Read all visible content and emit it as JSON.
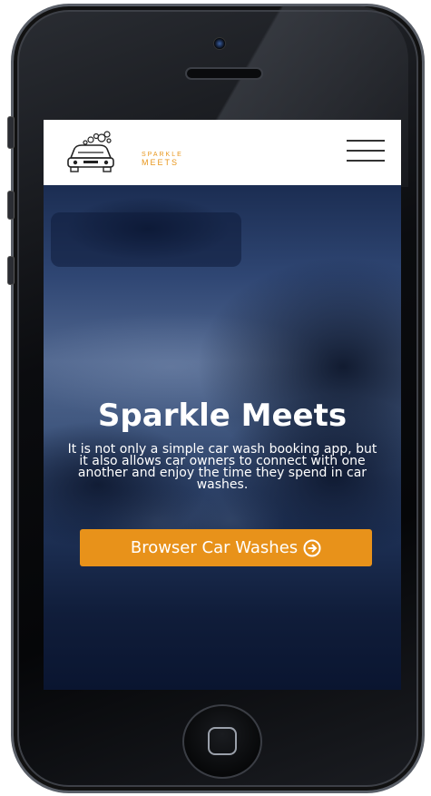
{
  "brand": {
    "logo_line1": "SPARKLE",
    "logo_line2": "MEETS",
    "accent_color": "#e8921a"
  },
  "nav": {
    "menu_icon": "hamburger-menu-icon"
  },
  "hero": {
    "title": "Sparkle Meets",
    "description": "It is not only a simple car wash booking app, but it also allows car owners to connect with one another and enjoy the time they spend in car washes.",
    "cta_label": "Browser Car Washes",
    "cta_icon": "arrow-right-circle-icon"
  },
  "device": {
    "frame": "smartphone",
    "home_button_icon": "home-square-icon"
  }
}
